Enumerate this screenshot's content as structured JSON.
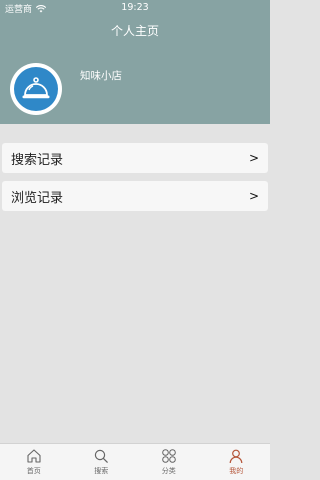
{
  "status": {
    "carrier": "运营商",
    "time": "19:23"
  },
  "header": {
    "title": "个人主页",
    "shop_name": "知味小店"
  },
  "menu": {
    "items": [
      {
        "label": "搜索记录",
        "chevron": ">"
      },
      {
        "label": "浏览记录",
        "chevron": ">"
      }
    ]
  },
  "tabbar": {
    "tabs": [
      {
        "label": "首页",
        "icon": "home-icon"
      },
      {
        "label": "搜索",
        "icon": "search-icon"
      },
      {
        "label": "分类",
        "icon": "category-icon"
      },
      {
        "label": "我的",
        "icon": "profile-icon",
        "active": true
      }
    ]
  },
  "colors": {
    "header": "#87a3a3",
    "avatar_bg": "#2f88c8",
    "active_tab": "#b5563a"
  }
}
